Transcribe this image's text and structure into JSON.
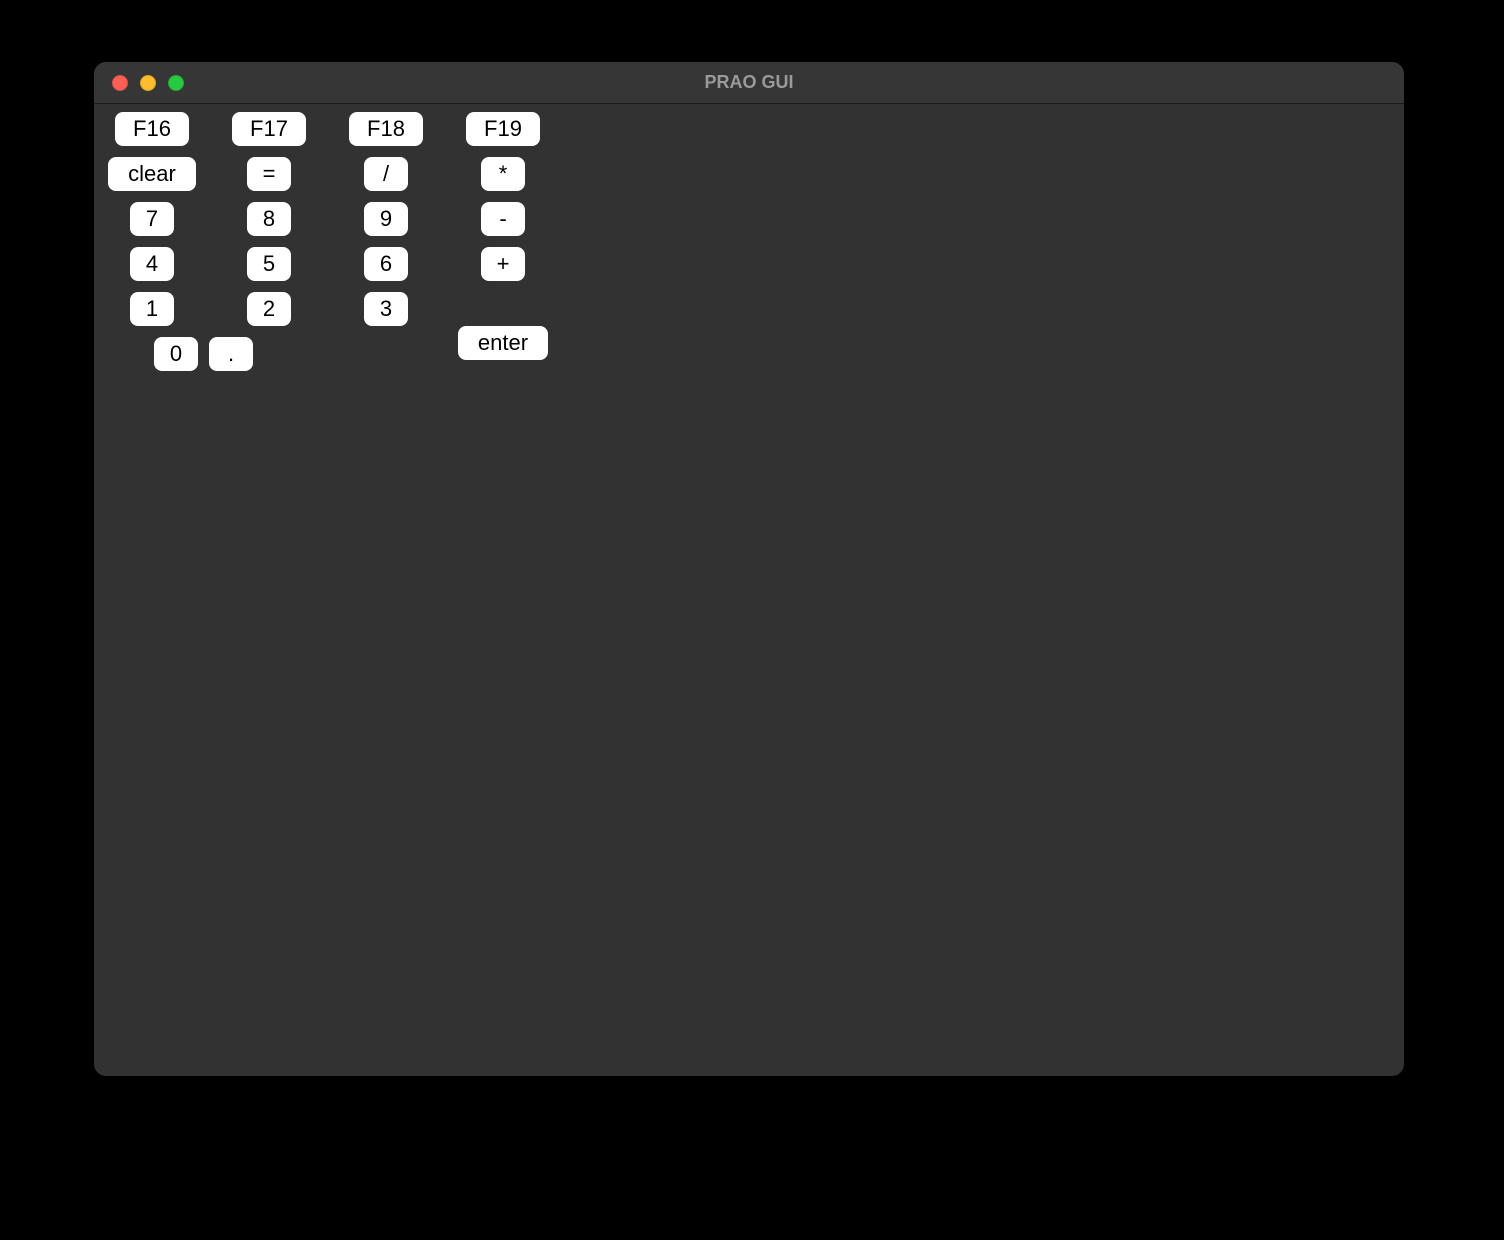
{
  "window": {
    "title": "PRAO GUI"
  },
  "keypad": {
    "row1": {
      "f16": "F16",
      "f17": "F17",
      "f18": "F18",
      "f19": "F19"
    },
    "row2": {
      "clear": "clear",
      "equals": "=",
      "divide": "/",
      "multiply": "*"
    },
    "row3": {
      "seven": "7",
      "eight": "8",
      "nine": "9",
      "minus": "-"
    },
    "row4": {
      "four": "4",
      "five": "5",
      "six": "6",
      "plus": "+"
    },
    "row5": {
      "one": "1",
      "two": "2",
      "three": "3"
    },
    "row6": {
      "zero": "0",
      "dot": "."
    },
    "enter": "enter"
  }
}
